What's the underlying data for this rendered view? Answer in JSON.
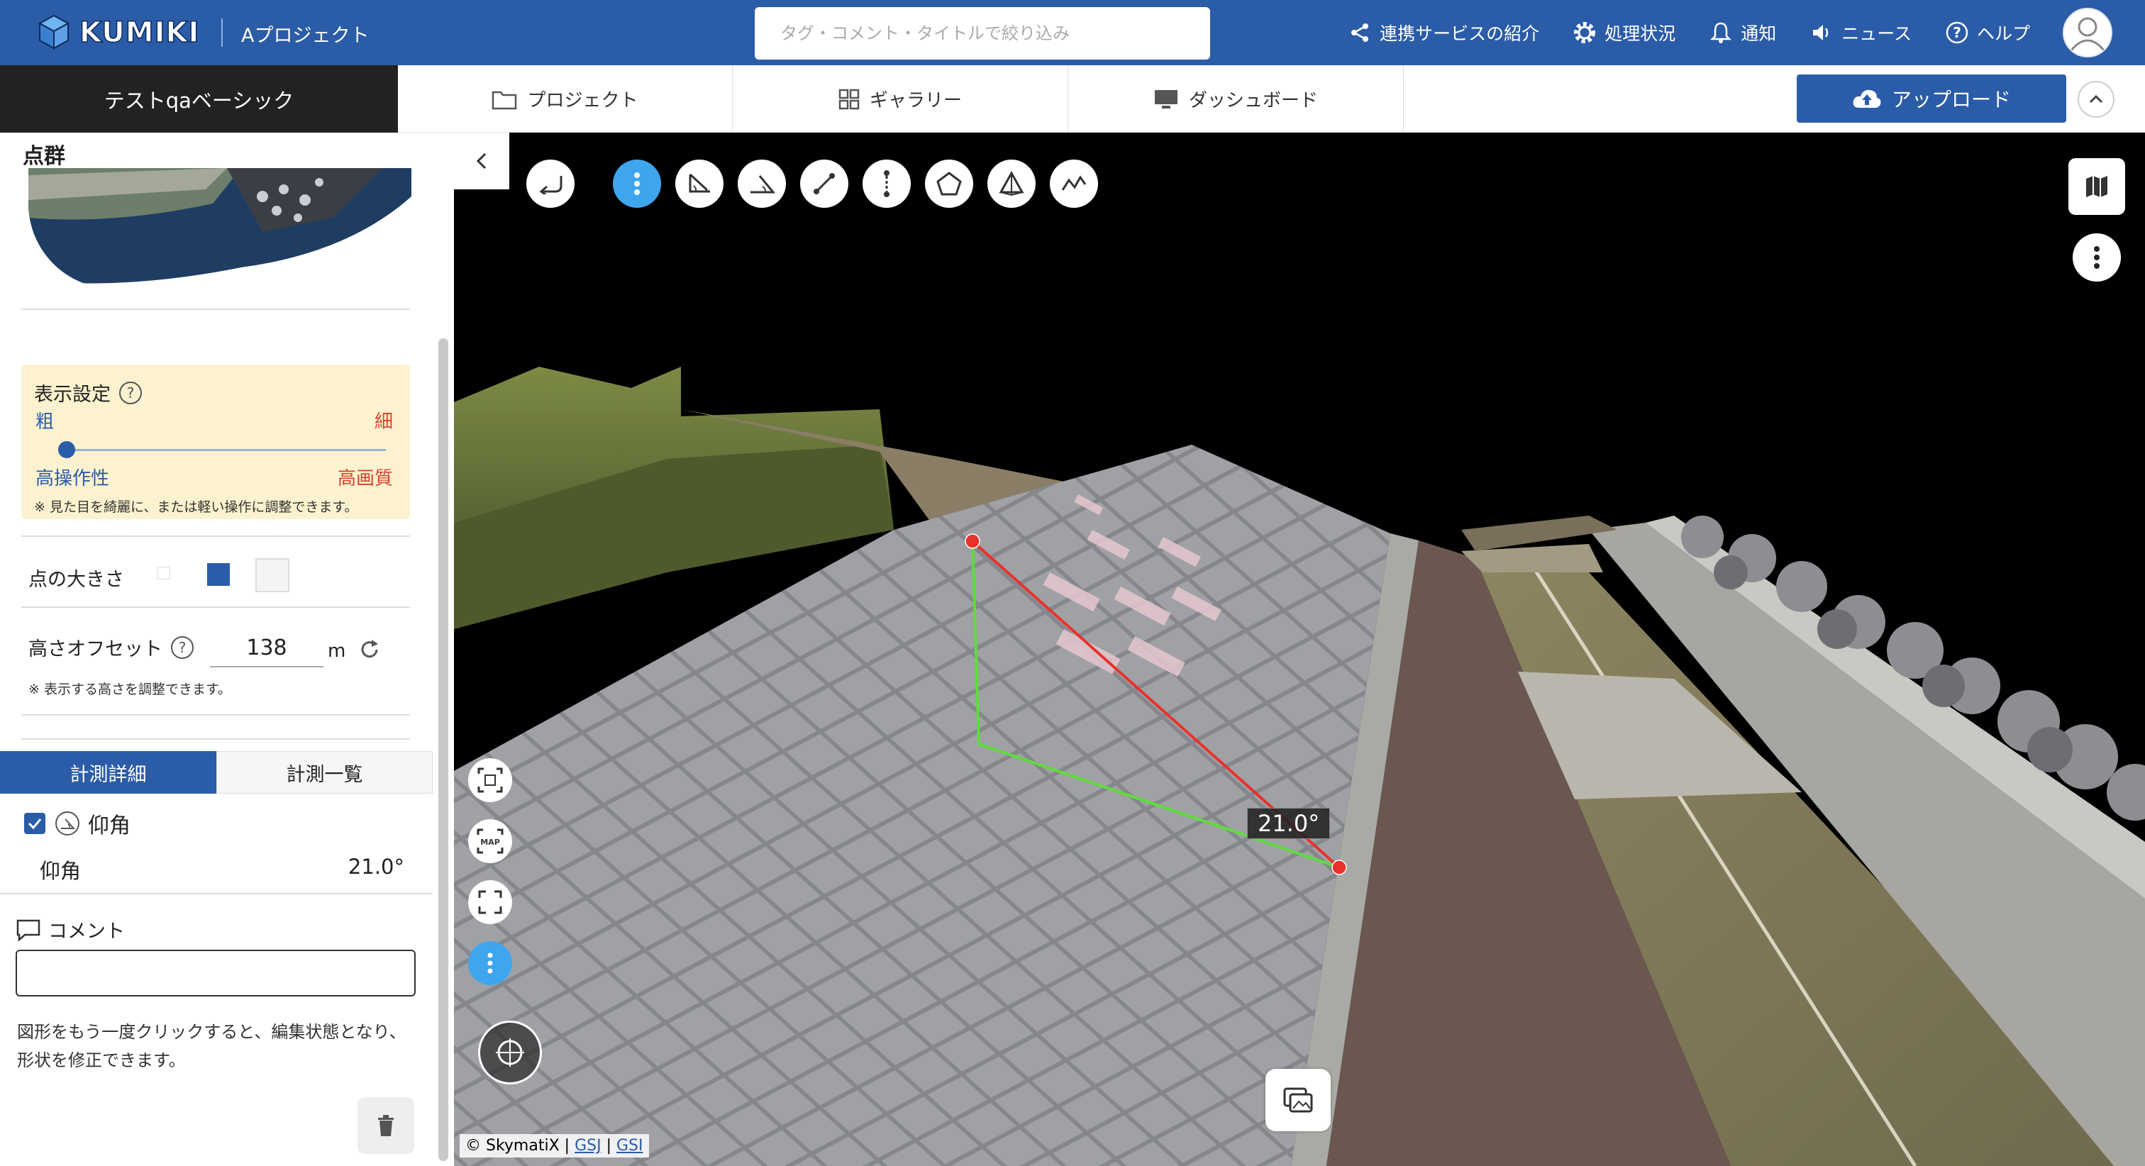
{
  "header": {
    "logo_text": "KUMIKI",
    "project_name": "Aプロジェクト",
    "search_placeholder": "タグ・コメント・タイトルで絞り込み",
    "nav": [
      {
        "label": "連携サービスの紹介",
        "icon": "share-icon"
      },
      {
        "label": "処理状況",
        "icon": "gear-icon"
      },
      {
        "label": "通知",
        "icon": "bell-icon"
      },
      {
        "label": "ニュース",
        "icon": "megaphone-icon"
      },
      {
        "label": "ヘルプ",
        "icon": "help-icon"
      }
    ]
  },
  "subnav": {
    "workspace": "テストqaベーシック",
    "tabs": [
      {
        "label": "プロジェクト",
        "icon": "folder-icon"
      },
      {
        "label": "ギャラリー",
        "icon": "grid-icon"
      },
      {
        "label": "ダッシュボード",
        "icon": "monitor-icon"
      }
    ],
    "upload_label": "アップロード"
  },
  "sidebar": {
    "title": "点群",
    "display": {
      "title": "表示設定",
      "coarse": "粗",
      "fine": "細",
      "performance": "高操作性",
      "quality": "高画質",
      "note": "※ 見た目を綺麗に、または軽い操作に調整できます。",
      "slider_value": 0
    },
    "point_size_label": "点の大きさ",
    "height_offset": {
      "label": "高さオフセット",
      "value": "138",
      "unit": "m",
      "note": "※ 表示する高さを調整できます。"
    },
    "tabs": {
      "detail": "計測詳細",
      "list": "計測一覧"
    },
    "measurement": {
      "type_label": "仰角",
      "checked": true,
      "name": "仰角",
      "value": "21.0°"
    },
    "comment_label": "コメント",
    "comment_value": "",
    "help_text": "図形をもう一度クリックすると、編集状態となり、形状を修正できます。"
  },
  "viewer": {
    "angle_label": "21.0°",
    "attribution": {
      "prefix": "© SkymatiX |",
      "gsj": "GSJ",
      "gsi": "GSI"
    },
    "toolbar": [
      "undo-icon",
      "more-vertical-icon",
      "angle-tool-icon",
      "elevation-angle-icon",
      "distance-icon",
      "height-icon",
      "polygon-icon",
      "volume-icon",
      "profile-icon"
    ],
    "colors": {
      "accent": "#2b5ca8",
      "active": "#3ea6ef",
      "measure_red": "#e8322b",
      "measure_green": "#5fdc3c"
    }
  }
}
